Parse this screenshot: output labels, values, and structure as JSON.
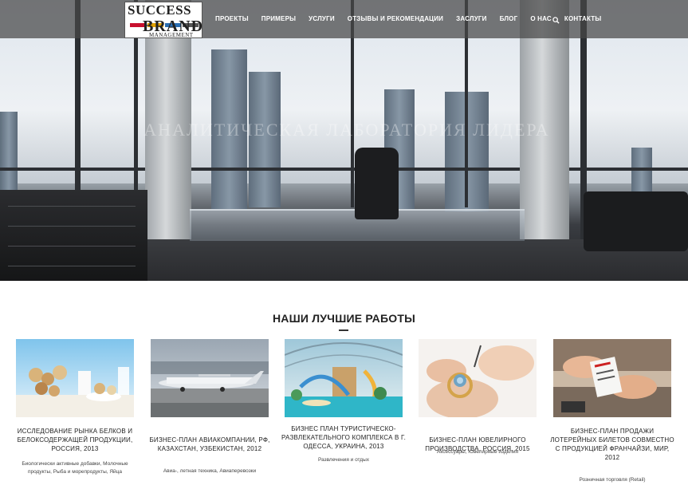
{
  "brand": {
    "logo_line1": "SUCCESS",
    "logo_line2": "BRAND",
    "logo_line3": "MANAGEMENT",
    "logo_stripe_colors": [
      "#c8102e",
      "#e0a000",
      "#2a6db0",
      "#555555"
    ]
  },
  "nav": {
    "items": [
      "ПРОЕКТЫ",
      "ПРИМЕРЫ",
      "УСЛУГИ",
      "ОТЗЫВЫ И РЕКОМЕНДАЦИИ",
      "ЗАСЛУГИ",
      "БЛОГ",
      "О НАС",
      "КОНТАКТЫ"
    ],
    "search_icon": "search-icon"
  },
  "hero": {
    "watermark": "АНАЛИТИЧЕСКАЯ ЛАБОРАТОРИЯ ЛИДЕРА"
  },
  "section": {
    "title": "НАШИ ЛУЧШИЕ РАБОТЫ"
  },
  "works": [
    {
      "title": "ИССЛЕДОВАНИЕ РЫНКА БЕЛКОВ И БЕЛОКСОДЕРЖАЩЕЙ ПРОДУКЦИИ, РОССИЯ, 2013",
      "tags": "Биологически активные добавки, Молочные продукты, Рыба и морепродукты, Яйца"
    },
    {
      "title": "БИЗНЕС-ПЛАН АВИАКОМПАНИИ, РФ, КАЗАХСТАН, УЗБЕКИСТАН, 2012",
      "tags": "Авиа-, летная техника, Авиаперевозки"
    },
    {
      "title": "БИЗНЕС ПЛАН ТУРИСТИЧЕСКО-РАЗВЛЕКАТЕЛЬНОГО КОМПЛЕКСА В Г. ОДЕССА, УКРАИНА, 2013",
      "tags": "Развлечения и отдых"
    },
    {
      "title": "БИЗНЕС-ПЛАН ЮВЕЛИРНОГО ПРОИЗВОДСТВА, РОССИЯ, 2015",
      "tags": "Аксессуары, Ювелирные изделия"
    },
    {
      "title": "БИЗНЕС-ПЛАН ПРОДАЖИ ЛОТЕРЕЙНЫХ БИЛЕТОВ СОВМЕСТНО С ПРОДУКЦИЕЙ ФРАНЧАЙЗИ, МИР, 2012",
      "tags": "Розничная торговля (Retail)"
    }
  ]
}
